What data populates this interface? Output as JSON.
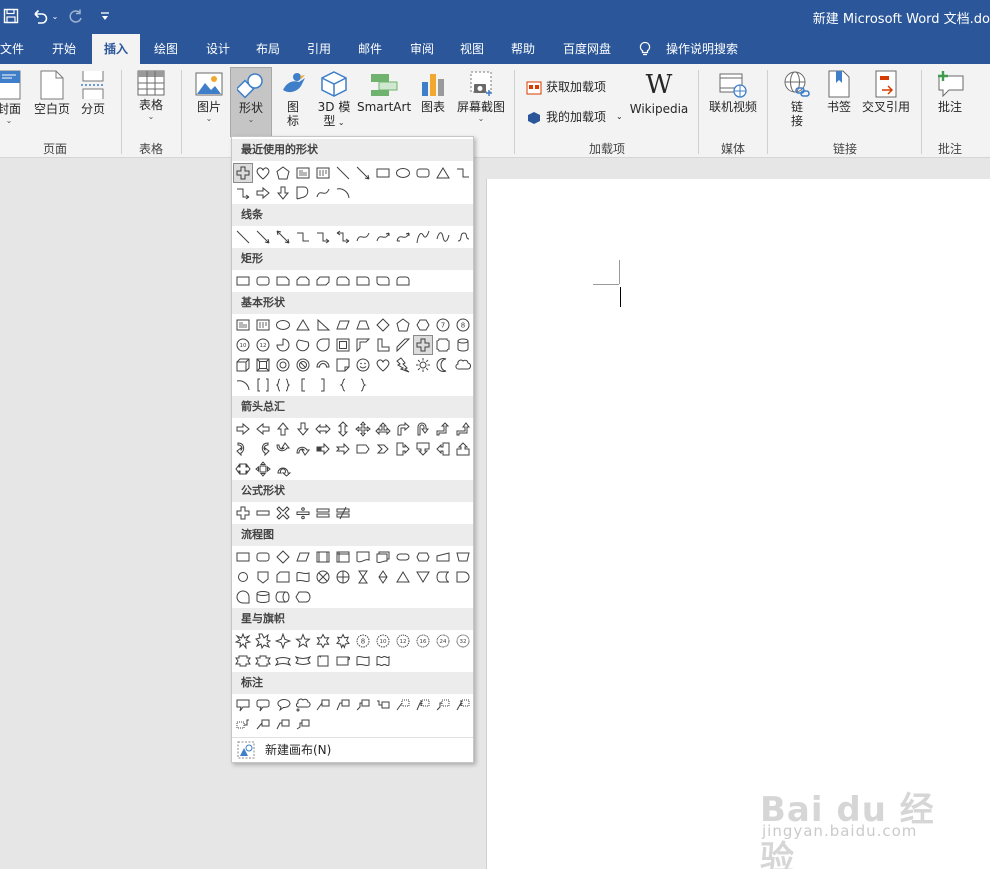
{
  "title_bar": {
    "document_title": "新建 Microsoft Word 文档.do",
    "quick_access": {
      "save": "save-icon",
      "undo": "undo-icon",
      "redo": "redo-icon",
      "customize": "customize-icon"
    }
  },
  "tabs": [
    "文件",
    "开始",
    "插入",
    "绘图",
    "设计",
    "布局",
    "引用",
    "邮件",
    "审阅",
    "视图",
    "帮助",
    "百度网盘"
  ],
  "active_tab": "插入",
  "tell_me": "操作说明搜索",
  "ribbon": {
    "buttons": {
      "cover": "封面",
      "blank_page": "空白页",
      "page_break": "分页",
      "table": "表格",
      "pictures": "图片",
      "shapes": "形状",
      "icons_line1": "图",
      "icons_line2": "标",
      "model3d_line1": "3D 模",
      "model3d_line2": "型",
      "smartart": "SmartArt",
      "chart": "图表",
      "screenshot": "屏幕截图",
      "get_addins": "获取加载项",
      "my_addins": "我的加载项",
      "wikipedia": "Wikipedia",
      "wikipedia_logo": "W",
      "online_video": "联机视频",
      "link_line1": "链",
      "link_line2": "接",
      "bookmark": "书签",
      "cross_reference": "交叉引用",
      "comment": "批注"
    },
    "groups": {
      "pages": "页面",
      "tables": "表格",
      "addins": "加载项",
      "media": "媒体",
      "links": "链接",
      "comments": "批注"
    }
  },
  "shapes_menu": {
    "sections": [
      "最近使用的形状",
      "线条",
      "矩形",
      "基本形状",
      "箭头总汇",
      "公式形状",
      "流程图",
      "星与旗帜",
      "标注"
    ],
    "new_canvas": "新建画布(N)"
  },
  "watermark": {
    "main": "Bai du 经验",
    "sub": "jingyan.baidu.com"
  },
  "colors": {
    "brand": "#2b579a",
    "ribbon_bg": "#f3f3f3",
    "canvas_bg": "#e6e6e6"
  }
}
